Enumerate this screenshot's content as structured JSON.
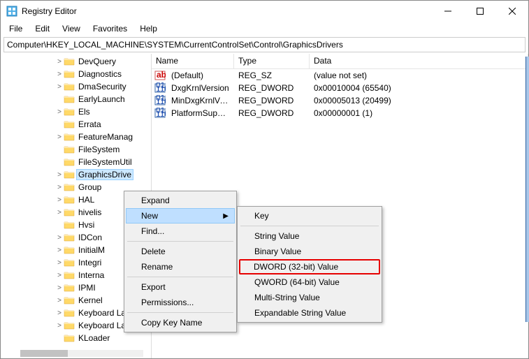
{
  "window": {
    "title": "Registry Editor"
  },
  "menubar": [
    "File",
    "Edit",
    "View",
    "Favorites",
    "Help"
  ],
  "address": "Computer\\HKEY_LOCAL_MACHINE\\SYSTEM\\CurrentControlSet\\Control\\GraphicsDrivers",
  "tree": [
    {
      "indent": 78,
      "exp": ">",
      "label": "DevQuery"
    },
    {
      "indent": 78,
      "exp": ">",
      "label": "Diagnostics"
    },
    {
      "indent": 78,
      "exp": ">",
      "label": "DmaSecurity"
    },
    {
      "indent": 78,
      "exp": "",
      "label": "EarlyLaunch"
    },
    {
      "indent": 78,
      "exp": ">",
      "label": "Els"
    },
    {
      "indent": 78,
      "exp": "",
      "label": "Errata"
    },
    {
      "indent": 78,
      "exp": ">",
      "label": "FeatureManag"
    },
    {
      "indent": 78,
      "exp": "",
      "label": "FileSystem"
    },
    {
      "indent": 78,
      "exp": "",
      "label": "FileSystemUtil"
    },
    {
      "indent": 78,
      "exp": ">",
      "label": "GraphicsDrive",
      "selected": true
    },
    {
      "indent": 78,
      "exp": ">",
      "label": "Group"
    },
    {
      "indent": 78,
      "exp": ">",
      "label": "HAL"
    },
    {
      "indent": 78,
      "exp": ">",
      "label": "hivelis"
    },
    {
      "indent": 78,
      "exp": "",
      "label": "Hvsi"
    },
    {
      "indent": 78,
      "exp": ">",
      "label": "IDCon"
    },
    {
      "indent": 78,
      "exp": ">",
      "label": "InitialM"
    },
    {
      "indent": 78,
      "exp": ">",
      "label": "Integri"
    },
    {
      "indent": 78,
      "exp": ">",
      "label": "Interna"
    },
    {
      "indent": 78,
      "exp": ">",
      "label": "IPMI"
    },
    {
      "indent": 78,
      "exp": ">",
      "label": "Kernel"
    },
    {
      "indent": 78,
      "exp": ">",
      "label": "Keyboard Lay"
    },
    {
      "indent": 78,
      "exp": ">",
      "label": "Keyboard Layo"
    },
    {
      "indent": 78,
      "exp": "",
      "label": "KLoader"
    }
  ],
  "columns": {
    "name": "Name",
    "type": "Type",
    "data": "Data"
  },
  "values": [
    {
      "icon": "sz",
      "name": "(Default)",
      "type": "REG_SZ",
      "data": "(value not set)"
    },
    {
      "icon": "bin",
      "name": "DxgKrnlVersion",
      "type": "REG_DWORD",
      "data": "0x00010004 (65540)"
    },
    {
      "icon": "bin",
      "name": "MinDxgKrnlVersi...",
      "type": "REG_DWORD",
      "data": "0x00005013 (20499)"
    },
    {
      "icon": "bin",
      "name": "PlatformSupport...",
      "type": "REG_DWORD",
      "data": "0x00000001 (1)"
    }
  ],
  "contextMenu1": {
    "expand": "Expand",
    "new": "New",
    "find": "Find...",
    "delete": "Delete",
    "rename": "Rename",
    "export": "Export",
    "permissions": "Permissions...",
    "copyKeyName": "Copy Key Name"
  },
  "contextMenu2": {
    "key": "Key",
    "string": "String Value",
    "binary": "Binary Value",
    "dword": "DWORD (32-bit) Value",
    "qword": "QWORD (64-bit) Value",
    "multi": "Multi-String Value",
    "expand": "Expandable String Value"
  }
}
